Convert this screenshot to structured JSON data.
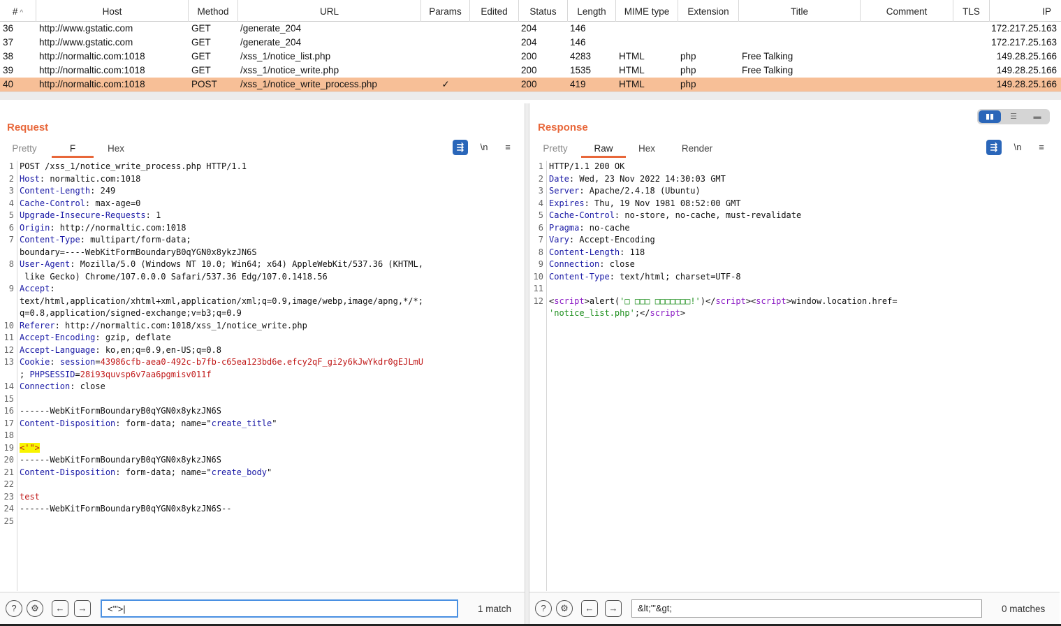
{
  "history": {
    "columns": [
      "#",
      "Host",
      "Method",
      "URL",
      "Params",
      "Edited",
      "Status",
      "Length",
      "MIME type",
      "Extension",
      "Title",
      "Comment",
      "TLS",
      "IP"
    ],
    "sort_indicator": "^",
    "rows": [
      {
        "id": "36",
        "host": "http://www.gstatic.com",
        "method": "GET",
        "url": "/generate_204",
        "params": "",
        "status": "204",
        "length": "146",
        "mime": "",
        "ext": "",
        "title": "",
        "ip": "172.217.25.163"
      },
      {
        "id": "37",
        "host": "http://www.gstatic.com",
        "method": "GET",
        "url": "/generate_204",
        "params": "",
        "status": "204",
        "length": "146",
        "mime": "",
        "ext": "",
        "title": "",
        "ip": "172.217.25.163"
      },
      {
        "id": "38",
        "host": "http://normaltic.com:1018",
        "method": "GET",
        "url": "/xss_1/notice_list.php",
        "params": "",
        "status": "200",
        "length": "4283",
        "mime": "HTML",
        "ext": "php",
        "title": "Free Talking",
        "ip": "149.28.25.166"
      },
      {
        "id": "39",
        "host": "http://normaltic.com:1018",
        "method": "GET",
        "url": "/xss_1/notice_write.php",
        "params": "",
        "status": "200",
        "length": "1535",
        "mime": "HTML",
        "ext": "php",
        "title": "Free Talking",
        "ip": "149.28.25.166"
      },
      {
        "id": "40",
        "host": "http://normaltic.com:1018",
        "method": "POST",
        "url": "/xss_1/notice_write_process.php",
        "params": "✓",
        "status": "200",
        "length": "419",
        "mime": "HTML",
        "ext": "php",
        "title": "",
        "ip": "149.28.25.166"
      }
    ]
  },
  "request": {
    "title": "Request",
    "tabs": [
      "Pretty",
      "F",
      "Hex"
    ],
    "active_tab": 1,
    "tool_icons": [
      "wrap-icon",
      "\\n",
      "≡"
    ],
    "search": {
      "value": "<'\">|",
      "result": "1 match"
    }
  },
  "response": {
    "title": "Response",
    "tabs": [
      "Pretty",
      "Raw",
      "Hex",
      "Render"
    ],
    "active_tab": 1,
    "tool_icons": [
      "wrap-icon",
      "\\n",
      "≡"
    ],
    "search": {
      "value": "&lt;'\"&gt;",
      "result": "0 matches"
    }
  },
  "request_lines": [
    {
      "n": "1",
      "parts": [
        {
          "t": "POST /xss_1/notice_write_process.php HTTP/1.1",
          "c": ""
        }
      ]
    },
    {
      "n": "2",
      "parts": [
        {
          "t": "Host",
          "c": "hkey"
        },
        {
          "t": ": normaltic.com:1018",
          "c": ""
        }
      ]
    },
    {
      "n": "3",
      "parts": [
        {
          "t": "Content-Length",
          "c": "hkey"
        },
        {
          "t": ": 249",
          "c": ""
        }
      ]
    },
    {
      "n": "4",
      "parts": [
        {
          "t": "Cache-Control",
          "c": "hkey"
        },
        {
          "t": ": max-age=0",
          "c": ""
        }
      ]
    },
    {
      "n": "5",
      "parts": [
        {
          "t": "Upgrade-Insecure-Requests",
          "c": "hkey"
        },
        {
          "t": ": 1",
          "c": ""
        }
      ]
    },
    {
      "n": "6",
      "parts": [
        {
          "t": "Origin",
          "c": "hkey"
        },
        {
          "t": ": http://normaltic.com:1018",
          "c": ""
        }
      ]
    },
    {
      "n": "7",
      "parts": [
        {
          "t": "Content-Type",
          "c": "hkey"
        },
        {
          "t": ": multipart/form-data;",
          "c": ""
        }
      ]
    },
    {
      "n": "",
      "parts": [
        {
          "t": "boundary=----WebKitFormBoundaryB0qYGN0x8ykzJN6S",
          "c": ""
        }
      ]
    },
    {
      "n": "8",
      "parts": [
        {
          "t": "User-Agent",
          "c": "hkey"
        },
        {
          "t": ": Mozilla/5.0 (Windows NT 10.0; Win64; x64) AppleWebKit/537.36 (KHTML,",
          "c": ""
        }
      ]
    },
    {
      "n": "",
      "parts": [
        {
          "t": " like Gecko) Chrome/107.0.0.0 Safari/537.36 Edg/107.0.1418.56",
          "c": ""
        }
      ]
    },
    {
      "n": "9",
      "parts": [
        {
          "t": "Accept",
          "c": "hkey"
        },
        {
          "t": ":",
          "c": ""
        }
      ]
    },
    {
      "n": "",
      "parts": [
        {
          "t": "text/html,application/xhtml+xml,application/xml;q=0.9,image/webp,image/apng,*/*;",
          "c": ""
        }
      ]
    },
    {
      "n": "",
      "parts": [
        {
          "t": "q=0.8,application/signed-exchange;v=b3;q=0.9",
          "c": ""
        }
      ]
    },
    {
      "n": "10",
      "parts": [
        {
          "t": "Referer",
          "c": "hkey"
        },
        {
          "t": ": http://normaltic.com:1018/xss_1/notice_write.php",
          "c": ""
        }
      ]
    },
    {
      "n": "11",
      "parts": [
        {
          "t": "Accept-Encoding",
          "c": "hkey"
        },
        {
          "t": ": gzip, deflate",
          "c": ""
        }
      ]
    },
    {
      "n": "12",
      "parts": [
        {
          "t": "Accept-Language",
          "c": "hkey"
        },
        {
          "t": ": ko,en;q=0.9,en-US;q=0.8",
          "c": ""
        }
      ]
    },
    {
      "n": "13",
      "parts": [
        {
          "t": "Cookie",
          "c": "hkey"
        },
        {
          "t": ": ",
          "c": ""
        },
        {
          "t": "session",
          "c": "hkey"
        },
        {
          "t": "=",
          "c": ""
        },
        {
          "t": "43986cfb-aea0-492c-b7fb-c65ea123bd6e.efcy2qF_gi2y6kJwYkdr0gEJLmU",
          "c": "cookie-val"
        }
      ]
    },
    {
      "n": "",
      "parts": [
        {
          "t": "; ",
          "c": ""
        },
        {
          "t": "PHPSESSID",
          "c": "hkey"
        },
        {
          "t": "=",
          "c": ""
        },
        {
          "t": "28i93quvsp6v7aa6pgmisv011f",
          "c": "cookie-val"
        }
      ]
    },
    {
      "n": "14",
      "parts": [
        {
          "t": "Connection",
          "c": "hkey"
        },
        {
          "t": ": close",
          "c": ""
        }
      ]
    },
    {
      "n": "15",
      "parts": [
        {
          "t": "",
          "c": ""
        }
      ]
    },
    {
      "n": "16",
      "parts": [
        {
          "t": "------WebKitFormBoundaryB0qYGN0x8ykzJN6S",
          "c": ""
        }
      ]
    },
    {
      "n": "17",
      "parts": [
        {
          "t": "Content-Disposition",
          "c": "hkey"
        },
        {
          "t": ": form-data; name=\"",
          "c": ""
        },
        {
          "t": "create_title",
          "c": "str"
        },
        {
          "t": "\"",
          "c": ""
        }
      ]
    },
    {
      "n": "18",
      "parts": [
        {
          "t": "",
          "c": ""
        }
      ]
    },
    {
      "n": "19",
      "hl": true,
      "parts": [
        {
          "t": "<'\">",
          "c": "hlyellow"
        }
      ]
    },
    {
      "n": "20",
      "parts": [
        {
          "t": "------WebKitFormBoundaryB0qYGN0x8ykzJN6S",
          "c": ""
        }
      ]
    },
    {
      "n": "21",
      "parts": [
        {
          "t": "Content-Disposition",
          "c": "hkey"
        },
        {
          "t": ": form-data; name=\"",
          "c": ""
        },
        {
          "t": "create_body",
          "c": "str"
        },
        {
          "t": "\"",
          "c": ""
        }
      ]
    },
    {
      "n": "22",
      "parts": [
        {
          "t": "",
          "c": ""
        }
      ]
    },
    {
      "n": "23",
      "parts": [
        {
          "t": "test",
          "c": "redtext"
        }
      ]
    },
    {
      "n": "24",
      "parts": [
        {
          "t": "------WebKitFormBoundaryB0qYGN0x8ykzJN6S--",
          "c": ""
        }
      ]
    },
    {
      "n": "25",
      "parts": [
        {
          "t": "",
          "c": ""
        }
      ]
    }
  ],
  "response_lines": [
    {
      "n": "1",
      "hl": true,
      "parts": [
        {
          "t": "HTTP/1.1 200 OK",
          "c": ""
        }
      ]
    },
    {
      "n": "2",
      "parts": [
        {
          "t": "Date",
          "c": "hkey"
        },
        {
          "t": ": Wed, 23 Nov 2022 14:30:03 GMT",
          "c": ""
        }
      ]
    },
    {
      "n": "3",
      "parts": [
        {
          "t": "Server",
          "c": "hkey"
        },
        {
          "t": ": Apache/2.4.18 (Ubuntu)",
          "c": ""
        }
      ]
    },
    {
      "n": "4",
      "parts": [
        {
          "t": "Expires",
          "c": "hkey"
        },
        {
          "t": ": Thu, 19 Nov 1981 08:52:00 GMT",
          "c": ""
        }
      ]
    },
    {
      "n": "5",
      "parts": [
        {
          "t": "Cache-Control",
          "c": "hkey"
        },
        {
          "t": ": no-store, no-cache, must-revalidate",
          "c": ""
        }
      ]
    },
    {
      "n": "6",
      "parts": [
        {
          "t": "Pragma",
          "c": "hkey"
        },
        {
          "t": ": no-cache",
          "c": ""
        }
      ]
    },
    {
      "n": "7",
      "parts": [
        {
          "t": "Vary",
          "c": "hkey"
        },
        {
          "t": ": Accept-Encoding",
          "c": ""
        }
      ]
    },
    {
      "n": "8",
      "parts": [
        {
          "t": "Content-Length",
          "c": "hkey"
        },
        {
          "t": ": 118",
          "c": ""
        }
      ]
    },
    {
      "n": "9",
      "parts": [
        {
          "t": "Connection",
          "c": "hkey"
        },
        {
          "t": ": close",
          "c": ""
        }
      ]
    },
    {
      "n": "10",
      "parts": [
        {
          "t": "Content-Type",
          "c": "hkey"
        },
        {
          "t": ": text/html; charset=UTF-8",
          "c": ""
        }
      ]
    },
    {
      "n": "11",
      "parts": [
        {
          "t": "",
          "c": ""
        }
      ]
    },
    {
      "n": "12",
      "parts": [
        {
          "t": "<",
          "c": ""
        },
        {
          "t": "script",
          "c": "tag"
        },
        {
          "t": ">alert(",
          "c": ""
        },
        {
          "t": "'□ □□□ □□□□□□□!'",
          "c": "attr-str"
        },
        {
          "t": ")</",
          "c": ""
        },
        {
          "t": "script",
          "c": "tag"
        },
        {
          "t": "><",
          "c": ""
        },
        {
          "t": "script",
          "c": "tag"
        },
        {
          "t": ">window.location.href=",
          "c": ""
        }
      ]
    },
    {
      "n": "",
      "parts": [
        {
          "t": "'notice_list.php'",
          "c": "attr-str"
        },
        {
          "t": ";</",
          "c": ""
        },
        {
          "t": "script",
          "c": "tag"
        },
        {
          "t": ">",
          "c": ""
        }
      ]
    }
  ],
  "colors": {
    "accent": "#e8673a",
    "selected_row": "#f7bf97",
    "blue_button": "#2a66b9"
  }
}
